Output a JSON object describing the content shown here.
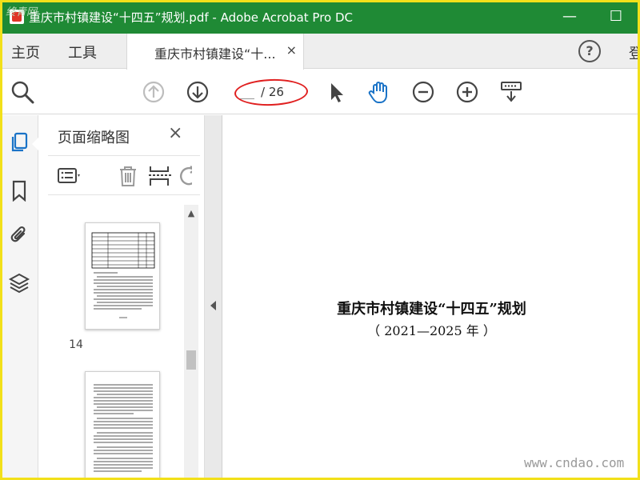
{
  "window": {
    "title": "重庆市村镇建设“十四五”规划.pdf - Adobe Acrobat Pro DC",
    "minimize": "—",
    "maximize": "☐",
    "watermark_top": "终青网"
  },
  "menu": {
    "home": "主页",
    "tools": "工具",
    "doc_tab_label": "重庆市村镇建设“十...",
    "doc_tab_close": "×",
    "help": "?",
    "sign_in": "登"
  },
  "toolbar": {
    "page_current": "",
    "page_total": "/ 26",
    "annotation_color": "#e02020"
  },
  "panel": {
    "title": "页面缩略图",
    "close": "×",
    "thumb_page_label": "14"
  },
  "document": {
    "title": "重庆市村镇建设“十四五”规划",
    "subtitle": "（ 2021—2025 年 ）"
  },
  "watermark": "www.cndao.com",
  "colors": {
    "titlebar": "#1f8a35",
    "accent_blue": "#1a73c7",
    "frame": "#f2e01a"
  },
  "icons": [
    "search-icon",
    "page-up-icon",
    "page-down-icon",
    "select-cursor-icon",
    "hand-tool-icon",
    "zoom-out-icon",
    "zoom-in-icon",
    "scroll-mode-icon",
    "page-thumbnails-icon",
    "bookmark-icon",
    "attachment-icon",
    "layers-icon",
    "options-menu-icon",
    "delete-icon",
    "insert-page-icon",
    "rotate-icon"
  ]
}
